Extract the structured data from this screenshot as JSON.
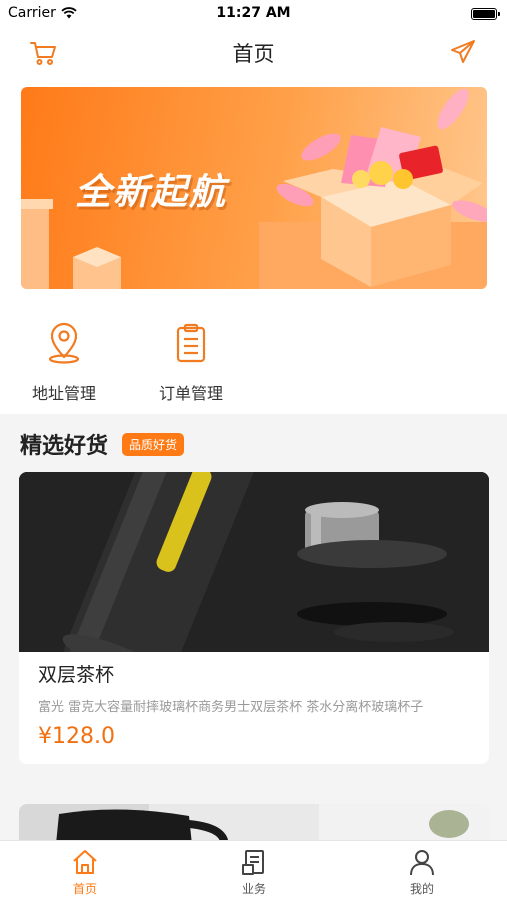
{
  "status_bar": {
    "carrier": "Carrier",
    "time": "11:27 AM",
    "battery_level": 1.0
  },
  "nav": {
    "title": "首页",
    "left_icon": "cart-icon",
    "right_icon": "send-icon"
  },
  "banner": {
    "text": "全新起航"
  },
  "quick_entries": [
    {
      "label": "地址管理",
      "icon": "location-pin-icon"
    },
    {
      "label": "订单管理",
      "icon": "clipboard-icon"
    }
  ],
  "section": {
    "title": "精选好货",
    "badge": "品质好货"
  },
  "products": [
    {
      "name": "双层茶杯",
      "description": "富光 雷克大容量耐摔玻璃杯商务男士双层茶杯 茶水分离杯玻璃杯子",
      "price": "¥128.0"
    }
  ],
  "tabs": [
    {
      "label": "首页",
      "icon": "home-icon",
      "active": true
    },
    {
      "label": "业务",
      "icon": "document-icon",
      "active": false
    },
    {
      "label": "我的",
      "icon": "user-icon",
      "active": false
    }
  ],
  "colors": {
    "accent": "#ff7a14",
    "price": "#f07012",
    "background": "#f4f4f4"
  }
}
